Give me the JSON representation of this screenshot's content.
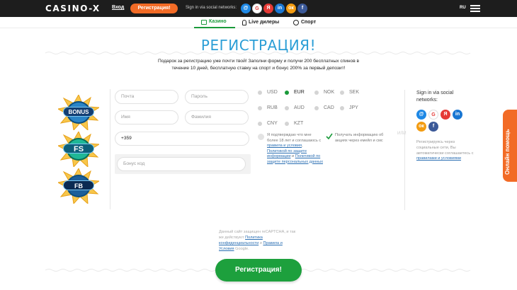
{
  "header": {
    "logo": "CASINO-X",
    "login": "Вход",
    "register": "Регистрация!",
    "social_label": "Sign in via social networks:",
    "socials": [
      {
        "icon": "at-icon",
        "glyph": "@",
        "color": "#1e88e5"
      },
      {
        "icon": "google-icon",
        "glyph": "G",
        "color": "#ffffff",
        "text_color": "#e53935"
      },
      {
        "icon": "yandex-icon",
        "glyph": "Я",
        "color": "#e53935"
      },
      {
        "icon": "linkedin-icon",
        "glyph": "in",
        "color": "#1976d2"
      },
      {
        "icon": "odnoklassniki-icon",
        "glyph": "ок",
        "color": "#f39c12"
      },
      {
        "icon": "facebook-icon",
        "glyph": "f",
        "color": "#3b5998"
      }
    ],
    "lang": "RU"
  },
  "nav": {
    "tabs": [
      {
        "label": "Казино",
        "active": true
      },
      {
        "label": "Live дилеры",
        "active": false
      },
      {
        "label": "Спорт",
        "active": false
      }
    ]
  },
  "title": "РЕГИСТРАЦИЯ!",
  "subtitle": "Подарок за регистрацию уже почти твой! Заполни форму и получи 200 бесплатных спинов в течение 10 дней, бесплатную ставку на спорт и бонус 200% за первый депозит!",
  "promo": {
    "badges": [
      "BONUS",
      "FS",
      "FB"
    ]
  },
  "form": {
    "email_placeholder": "Почта",
    "password_placeholder": "Пароль",
    "name_placeholder": "Имя",
    "surname_placeholder": "Фамилия",
    "phone_value": "+359",
    "bonus_placeholder": "Бонус код"
  },
  "currencies": {
    "items": [
      "USD",
      "EUR",
      "NOK",
      "SEK",
      "RUB",
      "AUD",
      "CAD",
      "JPY",
      "CNY",
      "KZT"
    ],
    "selected": "EUR"
  },
  "consent": {
    "age_text_pre": "Я подтверждаю что мне более 18 лет и соглашаюсь с",
    "age_link1": "правила и условия",
    "age_sep1": ",",
    "age_link2": "Политикой по защите информации",
    "age_sep2": "и",
    "age_link3": "Политикой по защите персональных данных",
    "news_text": "Получать информацию об акциях через емейл и смс",
    "or": "ИЛИ"
  },
  "right": {
    "title": "Sign in via social networks:",
    "hint_pre": "Регистрируясь через социальные сети, Вы автоматически соглашаетесь с",
    "hint_link": "правилами и условиями"
  },
  "help_tab": "Онлайн помощь",
  "bottom": {
    "hint_pre": "Данный сайт защищен reCAPTCHA, и так же действуют",
    "hint_link1": "Политика конфиденциальности",
    "hint_sep": "и",
    "hint_link2": "Правила и Условия",
    "hint_post": "Google.",
    "register_button": "Регистрация!"
  }
}
